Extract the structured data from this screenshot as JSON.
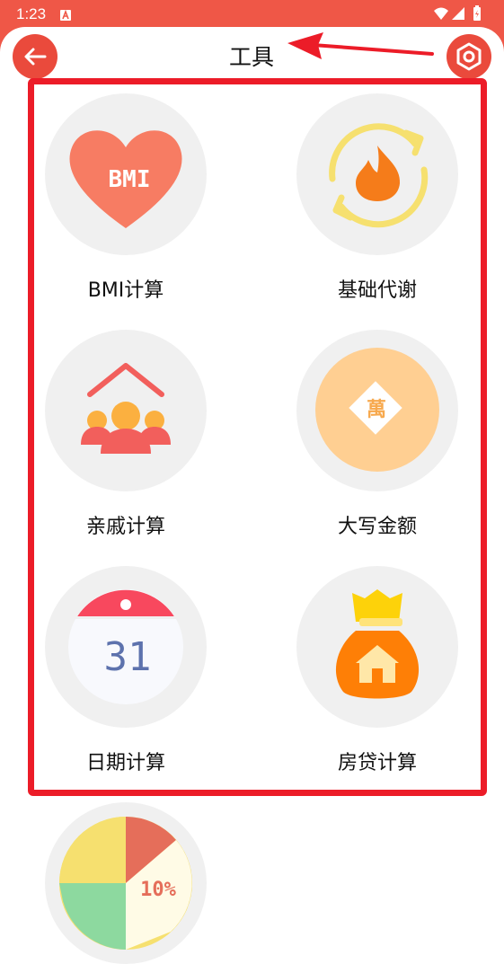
{
  "status_bar": {
    "time": "1:23"
  },
  "header": {
    "title": "工具"
  },
  "tools": [
    {
      "label": "BMI计算",
      "icon": "heart-bmi-icon",
      "icon_text": "BMI"
    },
    {
      "label": "基础代谢",
      "icon": "flame-cycle-icon"
    },
    {
      "label": "亲戚计算",
      "icon": "family-house-icon"
    },
    {
      "label": "大写金额",
      "icon": "wan-coin-icon",
      "icon_text": "萬"
    },
    {
      "label": "日期计算",
      "icon": "calendar-icon",
      "icon_text": "31"
    },
    {
      "label": "房贷计算",
      "icon": "money-bag-house-icon"
    },
    {
      "label": "",
      "icon": "pie-chart-icon",
      "icon_text": "10%"
    }
  ],
  "colors": {
    "accent": "#ef5747",
    "highlight": "#ec1c28",
    "circle_bg": "#f0f0f0"
  }
}
